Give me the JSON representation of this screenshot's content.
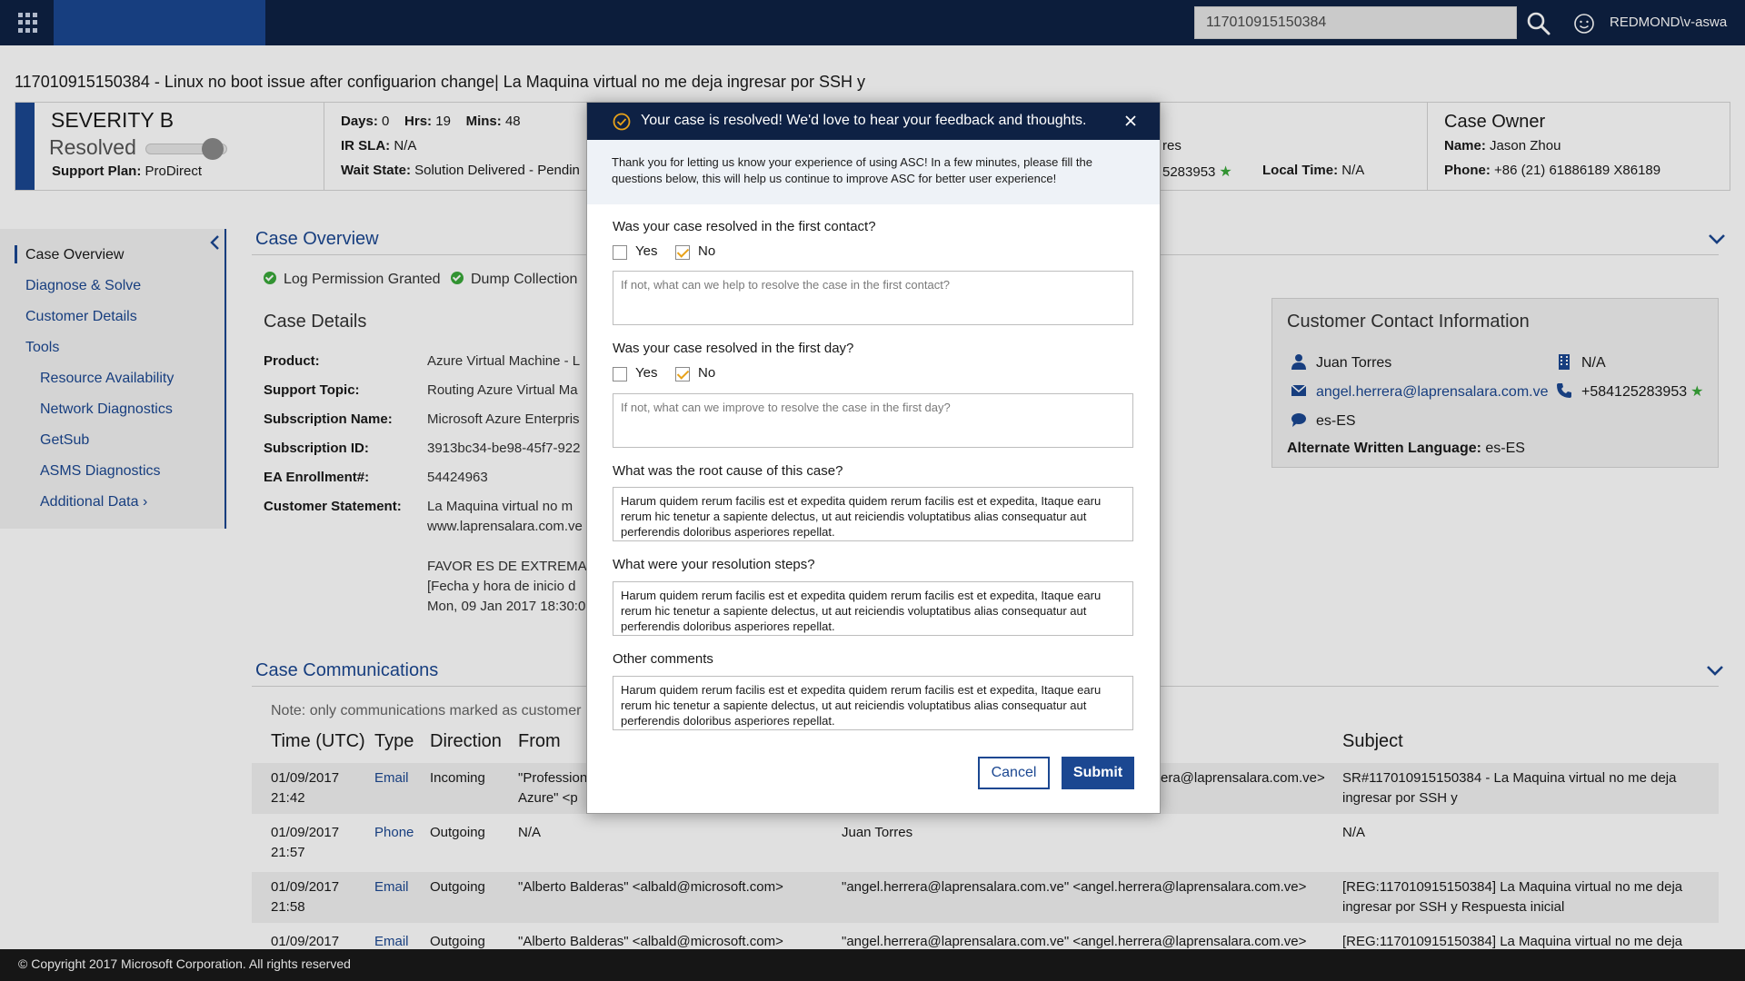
{
  "topbar": {
    "search_value": "117010915150384",
    "user": "REDMOND\\v-aswa"
  },
  "case_title": "117010915150384 - Linux no boot issue after configuarion change| La Maquina virtual no me deja ingresar por SSH y",
  "summary": {
    "severity": "SEVERITY B",
    "status": "Resolved",
    "support_plan_label": "Support Plan:",
    "support_plan_value": "ProDirect",
    "days_label": "Days:",
    "days_value": "0",
    "hrs_label": "Hrs:",
    "hrs_value": "19",
    "mins_label": "Mins:",
    "mins_value": "48",
    "ir_sla_label": "IR SLA:",
    "ir_sla_value": "N/A",
    "wait_state_label": "Wait State:",
    "wait_state_value": "Solution Delivered - Pendin",
    "contact_partial_1": "res",
    "contact_partial_2": "5283953",
    "local_time_label": "Local Time:",
    "local_time_value": "N/A",
    "owner_title": "Case Owner",
    "owner_name_label": "Name:",
    "owner_name_value": "Jason Zhou",
    "owner_phone_label": "Phone:",
    "owner_phone_value": "+86 (21) 61886189 X86189"
  },
  "sidebar": {
    "items": [
      {
        "label": "Case Overview"
      },
      {
        "label": "Diagnose & Solve"
      },
      {
        "label": "Customer Details"
      },
      {
        "label": "Tools"
      },
      {
        "label": "Resource Availability"
      },
      {
        "label": "Network Diagnostics"
      },
      {
        "label": "GetSub"
      },
      {
        "label": "ASMS Diagnostics"
      },
      {
        "label": "Additional Data"
      }
    ]
  },
  "overview": {
    "title": "Case Overview",
    "permission_1": "Log Permission Granted",
    "permission_2": "Dump Collection",
    "details_title": "Case Details",
    "details": [
      {
        "label": "Product:",
        "value": "Azure Virtual Machine - L"
      },
      {
        "label": "Support Topic:",
        "value": "Routing Azure Virtual Ma"
      },
      {
        "label": "Subscription Name:",
        "value": "Microsoft Azure Enterpris"
      },
      {
        "label": "Subscription ID:",
        "value": "3913bc34-be98-45f7-922"
      },
      {
        "label": "EA Enrollment#:",
        "value": "54424963"
      },
      {
        "label": "Customer Statement:",
        "value": "La Maquina virtual no m"
      }
    ],
    "statement_lines": [
      "www.laprensalara.com.ve",
      "FAVOR ES DE EXTREMA U",
      "[Fecha y hora de inicio d",
      "Mon, 09 Jan 2017 18:30:0"
    ]
  },
  "contact": {
    "title": "Customer Contact Information",
    "name": "Juan Torres",
    "company": "N/A",
    "email": "angel.herrera@laprensalara.com.ve",
    "phone": "+584125283953",
    "language": "es-ES",
    "alt_language_label": "Alternate Written Language:",
    "alt_language_value": "es-ES"
  },
  "communications": {
    "title": "Case Communications",
    "note": "Note: only communications marked as customer",
    "headers": [
      "Time (UTC)",
      "Type",
      "Direction",
      "From",
      "Subject"
    ],
    "rows": [
      {
        "date": "01/09/2017",
        "time": "21:42",
        "type": "Email",
        "direction": "Incoming",
        "from_1": "\"Profession",
        "from_2": "Azure\" <p",
        "to": "era@laprensalara.com.ve>",
        "subject": "SR#117010915150384 - La Maquina virtual no me deja ingresar por SSH y"
      },
      {
        "date": "01/09/2017",
        "time": "21:57",
        "type": "Phone",
        "direction": "Outgoing",
        "from_1": "N/A",
        "from_2": "",
        "to": "Juan Torres",
        "subject": "N/A"
      },
      {
        "date": "01/09/2017",
        "time": "21:58",
        "type": "Email",
        "direction": "Outgoing",
        "from_1": "\"Alberto Balderas\" <albald@microsoft.com>",
        "from_2": "",
        "to": "\"angel.herrera@laprensalara.com.ve\" <angel.herrera@laprensalara.com.ve>",
        "subject": "[REG:117010915150384] La Maquina virtual no me deja ingresar por SSH y Respuesta inicial"
      },
      {
        "date": "01/09/2017",
        "time": "",
        "type": "Email",
        "direction": "Outgoing",
        "from_1": "\"Alberto Balderas\" <albald@microsoft.com>",
        "from_2": "",
        "to": "\"angel.herrera@laprensalara.com.ve\" <angel.herrera@laprensalara.com.ve>",
        "subject": "[REG:117010915150384] La Maquina virtual no me deja"
      }
    ]
  },
  "footer": "© Copyright 2017 Microsoft Corporation. All rights reserved",
  "modal": {
    "title": "Your case is resolved! We'd love to hear your feedback and thoughts.",
    "intro": "Thank you for letting us know your experience of using ASC! In a few minutes, please fill the questions below, this will help us continue to improve ASC for better user experience!",
    "q1": "Was your case resolved in the first contact?",
    "q1_yes": "Yes",
    "q1_no": "No",
    "q1_placeholder": "If not, what can we help to resolve the case in the first contact?",
    "q2": "Was your case resolved in the first day?",
    "q2_yes": "Yes",
    "q2_no": "No",
    "q2_placeholder": "If not, what can we improve to resolve the case in the first day?",
    "q3": "What was the root cause of this case?",
    "q3_value": "Harum quidem rerum facilis est et expedita quidem rerum facilis est et expedita, Itaque earu rerum hic tenetur a sapiente delectus, ut aut reiciendis voluptatibus alias consequatur aut perferendis doloribus asperiores repellat.",
    "q4": "What were your resolution steps?",
    "q4_value": "Harum quidem rerum facilis est et expedita quidem rerum facilis est et expedita, Itaque earu rerum hic tenetur a sapiente delectus, ut aut reiciendis voluptatibus alias consequatur aut perferendis doloribus asperiores repellat.",
    "q5": "Other comments",
    "q5_value": "Harum quidem rerum facilis est et expedita quidem rerum facilis est et expedita, Itaque earu rerum hic tenetur a sapiente delectus, ut aut reiciendis voluptatibus alias consequatur aut perferendis doloribus asperiores repellat.",
    "cancel": "Cancel",
    "submit": "Submit"
  },
  "colors": {
    "navy": "#0e2144",
    "accent": "#1b4791",
    "success": "#3aa83a",
    "check": "#e8a21a"
  }
}
